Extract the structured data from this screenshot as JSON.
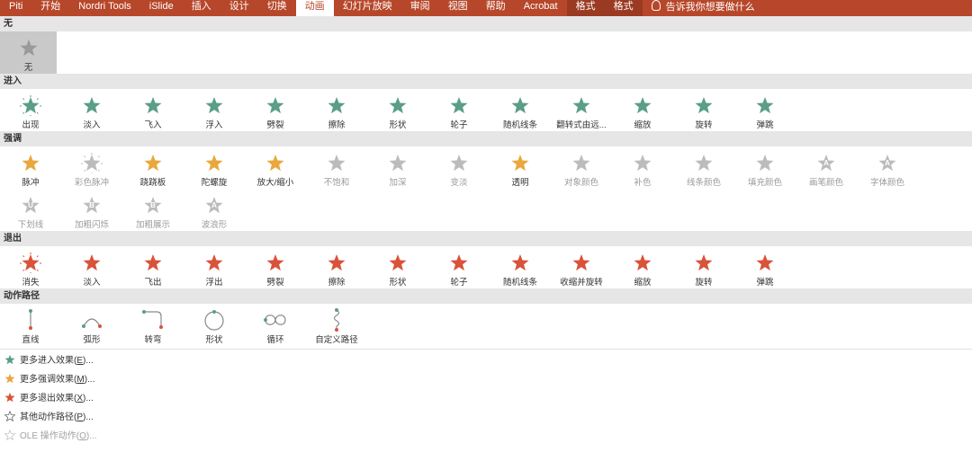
{
  "ribbon": {
    "tabs": [
      "Piti",
      "开始",
      "Nordri Tools",
      "iSlide",
      "插入",
      "设计",
      "切换",
      "动画",
      "幻灯片放映",
      "审阅",
      "视图",
      "帮助",
      "Acrobat",
      "格式",
      "格式"
    ],
    "active_index": 7,
    "tell_me": "告诉我你想要做什么"
  },
  "colors": {
    "accent": "#b7472a",
    "enter": "#5a9e86",
    "emphasis": "#e9a83c",
    "exit": "#d9533a",
    "disabled": "#bcbcbc",
    "path": "#8a8a8a"
  },
  "sections": {
    "none": {
      "title": "无",
      "items": [
        {
          "label": "无"
        }
      ]
    },
    "enter": {
      "title": "进入",
      "items": [
        {
          "label": "出现"
        },
        {
          "label": "淡入"
        },
        {
          "label": "飞入"
        },
        {
          "label": "浮入"
        },
        {
          "label": "劈裂"
        },
        {
          "label": "擦除"
        },
        {
          "label": "形状"
        },
        {
          "label": "轮子"
        },
        {
          "label": "随机线条"
        },
        {
          "label": "翻转式由远..."
        },
        {
          "label": "缩放"
        },
        {
          "label": "旋转"
        },
        {
          "label": "弹跳"
        }
      ]
    },
    "emphasis": {
      "title": "强调",
      "items": [
        {
          "label": "脉冲",
          "enabled": true
        },
        {
          "label": "彩色脉冲",
          "enabled": false
        },
        {
          "label": "跷跷板",
          "enabled": true
        },
        {
          "label": "陀螺旋",
          "enabled": true
        },
        {
          "label": "放大/缩小",
          "enabled": true
        },
        {
          "label": "不饱和",
          "enabled": false
        },
        {
          "label": "加深",
          "enabled": false
        },
        {
          "label": "变淡",
          "enabled": false
        },
        {
          "label": "透明",
          "enabled": true
        },
        {
          "label": "对象颜色",
          "enabled": false
        },
        {
          "label": "补色",
          "enabled": false
        },
        {
          "label": "线条颜色",
          "enabled": false
        },
        {
          "label": "填充颜色",
          "enabled": false
        },
        {
          "label": "画笔颜色",
          "enabled": false,
          "glyph": "A"
        },
        {
          "label": "字体颜色",
          "enabled": false,
          "glyph": "A"
        },
        {
          "label": "下划线",
          "enabled": false,
          "glyph": "U"
        },
        {
          "label": "加粗闪烁",
          "enabled": false,
          "glyph": "B"
        },
        {
          "label": "加粗展示",
          "enabled": false,
          "glyph": "B"
        },
        {
          "label": "波浪形",
          "enabled": false,
          "glyph": "A"
        }
      ]
    },
    "exit": {
      "title": "退出",
      "items": [
        {
          "label": "消失"
        },
        {
          "label": "淡入"
        },
        {
          "label": "飞出"
        },
        {
          "label": "浮出"
        },
        {
          "label": "劈裂"
        },
        {
          "label": "擦除"
        },
        {
          "label": "形状"
        },
        {
          "label": "轮子"
        },
        {
          "label": "随机线条"
        },
        {
          "label": "收缩并旋转"
        },
        {
          "label": "缩放"
        },
        {
          "label": "旋转"
        },
        {
          "label": "弹跳"
        }
      ]
    },
    "paths": {
      "title": "动作路径",
      "items": [
        {
          "label": "直线",
          "icon": "line-path-icon"
        },
        {
          "label": "弧形",
          "icon": "arc-path-icon"
        },
        {
          "label": "转弯",
          "icon": "turn-path-icon"
        },
        {
          "label": "形状",
          "icon": "circle-path-icon"
        },
        {
          "label": "循环",
          "icon": "loop-path-icon"
        },
        {
          "label": "自定义路径",
          "icon": "custom-path-icon"
        }
      ]
    }
  },
  "menu": [
    {
      "label": "更多进入效果(E)...",
      "key": "E",
      "pre": "更多进入效果(",
      "post": ")...",
      "icon": "green-star-icon",
      "enabled": true
    },
    {
      "label": "更多强调效果(M)...",
      "key": "M",
      "pre": "更多强调效果(",
      "post": ")...",
      "icon": "gold-star-icon",
      "enabled": true
    },
    {
      "label": "更多退出效果(X)...",
      "key": "X",
      "pre": "更多退出效果(",
      "post": ")...",
      "icon": "red-star-icon",
      "enabled": true
    },
    {
      "label": "其他动作路径(P)...",
      "key": "P",
      "pre": "其他动作路径(",
      "post": ")...",
      "icon": "outline-star-icon",
      "enabled": true
    },
    {
      "label": "OLE 操作动作(O)...",
      "key": "O",
      "pre": "OLE 操作动作(",
      "post": ")...",
      "icon": "ole-gear-icon",
      "enabled": false
    }
  ]
}
